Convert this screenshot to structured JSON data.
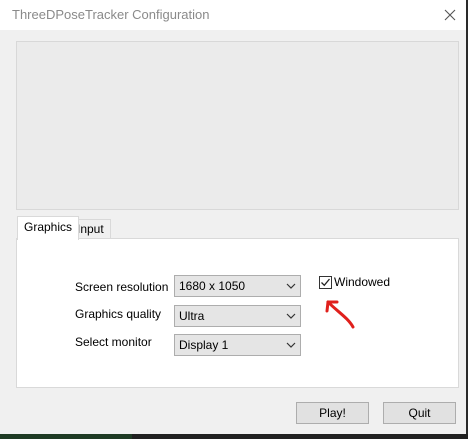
{
  "window": {
    "title": "ThreeDPoseTracker Configuration"
  },
  "tabs": [
    {
      "label": "Graphics",
      "selected": true
    },
    {
      "label": "Input",
      "selected": false
    }
  ],
  "graphics": {
    "screen_resolution": {
      "label": "Screen resolution",
      "value": "1680 x 1050"
    },
    "graphics_quality": {
      "label": "Graphics quality",
      "value": "Ultra"
    },
    "select_monitor": {
      "label": "Select monitor",
      "value": "Display 1"
    },
    "windowed": {
      "label": "Windowed",
      "checked": true
    }
  },
  "buttons": {
    "play_label": "Play!",
    "quit_label": "Quit"
  },
  "annotation": {
    "color": "#e0201c"
  },
  "icons": [
    "close-icon",
    "chevron-down-icon",
    "checkmark-icon",
    "annotation-arrow-icon"
  ]
}
